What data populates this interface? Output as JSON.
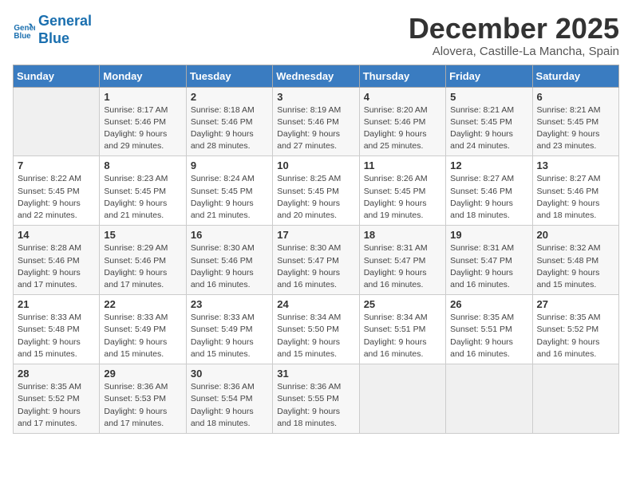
{
  "logo": {
    "line1": "General",
    "line2": "Blue"
  },
  "title": "December 2025",
  "location": "Alovera, Castille-La Mancha, Spain",
  "days_of_week": [
    "Sunday",
    "Monday",
    "Tuesday",
    "Wednesday",
    "Thursday",
    "Friday",
    "Saturday"
  ],
  "weeks": [
    [
      {
        "num": "",
        "info": ""
      },
      {
        "num": "1",
        "info": "Sunrise: 8:17 AM\nSunset: 5:46 PM\nDaylight: 9 hours\nand 29 minutes."
      },
      {
        "num": "2",
        "info": "Sunrise: 8:18 AM\nSunset: 5:46 PM\nDaylight: 9 hours\nand 28 minutes."
      },
      {
        "num": "3",
        "info": "Sunrise: 8:19 AM\nSunset: 5:46 PM\nDaylight: 9 hours\nand 27 minutes."
      },
      {
        "num": "4",
        "info": "Sunrise: 8:20 AM\nSunset: 5:46 PM\nDaylight: 9 hours\nand 25 minutes."
      },
      {
        "num": "5",
        "info": "Sunrise: 8:21 AM\nSunset: 5:45 PM\nDaylight: 9 hours\nand 24 minutes."
      },
      {
        "num": "6",
        "info": "Sunrise: 8:21 AM\nSunset: 5:45 PM\nDaylight: 9 hours\nand 23 minutes."
      }
    ],
    [
      {
        "num": "7",
        "info": "Sunrise: 8:22 AM\nSunset: 5:45 PM\nDaylight: 9 hours\nand 22 minutes."
      },
      {
        "num": "8",
        "info": "Sunrise: 8:23 AM\nSunset: 5:45 PM\nDaylight: 9 hours\nand 21 minutes."
      },
      {
        "num": "9",
        "info": "Sunrise: 8:24 AM\nSunset: 5:45 PM\nDaylight: 9 hours\nand 21 minutes."
      },
      {
        "num": "10",
        "info": "Sunrise: 8:25 AM\nSunset: 5:45 PM\nDaylight: 9 hours\nand 20 minutes."
      },
      {
        "num": "11",
        "info": "Sunrise: 8:26 AM\nSunset: 5:45 PM\nDaylight: 9 hours\nand 19 minutes."
      },
      {
        "num": "12",
        "info": "Sunrise: 8:27 AM\nSunset: 5:46 PM\nDaylight: 9 hours\nand 18 minutes."
      },
      {
        "num": "13",
        "info": "Sunrise: 8:27 AM\nSunset: 5:46 PM\nDaylight: 9 hours\nand 18 minutes."
      }
    ],
    [
      {
        "num": "14",
        "info": "Sunrise: 8:28 AM\nSunset: 5:46 PM\nDaylight: 9 hours\nand 17 minutes."
      },
      {
        "num": "15",
        "info": "Sunrise: 8:29 AM\nSunset: 5:46 PM\nDaylight: 9 hours\nand 17 minutes."
      },
      {
        "num": "16",
        "info": "Sunrise: 8:30 AM\nSunset: 5:46 PM\nDaylight: 9 hours\nand 16 minutes."
      },
      {
        "num": "17",
        "info": "Sunrise: 8:30 AM\nSunset: 5:47 PM\nDaylight: 9 hours\nand 16 minutes."
      },
      {
        "num": "18",
        "info": "Sunrise: 8:31 AM\nSunset: 5:47 PM\nDaylight: 9 hours\nand 16 minutes."
      },
      {
        "num": "19",
        "info": "Sunrise: 8:31 AM\nSunset: 5:47 PM\nDaylight: 9 hours\nand 16 minutes."
      },
      {
        "num": "20",
        "info": "Sunrise: 8:32 AM\nSunset: 5:48 PM\nDaylight: 9 hours\nand 15 minutes."
      }
    ],
    [
      {
        "num": "21",
        "info": "Sunrise: 8:33 AM\nSunset: 5:48 PM\nDaylight: 9 hours\nand 15 minutes."
      },
      {
        "num": "22",
        "info": "Sunrise: 8:33 AM\nSunset: 5:49 PM\nDaylight: 9 hours\nand 15 minutes."
      },
      {
        "num": "23",
        "info": "Sunrise: 8:33 AM\nSunset: 5:49 PM\nDaylight: 9 hours\nand 15 minutes."
      },
      {
        "num": "24",
        "info": "Sunrise: 8:34 AM\nSunset: 5:50 PM\nDaylight: 9 hours\nand 15 minutes."
      },
      {
        "num": "25",
        "info": "Sunrise: 8:34 AM\nSunset: 5:51 PM\nDaylight: 9 hours\nand 16 minutes."
      },
      {
        "num": "26",
        "info": "Sunrise: 8:35 AM\nSunset: 5:51 PM\nDaylight: 9 hours\nand 16 minutes."
      },
      {
        "num": "27",
        "info": "Sunrise: 8:35 AM\nSunset: 5:52 PM\nDaylight: 9 hours\nand 16 minutes."
      }
    ],
    [
      {
        "num": "28",
        "info": "Sunrise: 8:35 AM\nSunset: 5:52 PM\nDaylight: 9 hours\nand 17 minutes."
      },
      {
        "num": "29",
        "info": "Sunrise: 8:36 AM\nSunset: 5:53 PM\nDaylight: 9 hours\nand 17 minutes."
      },
      {
        "num": "30",
        "info": "Sunrise: 8:36 AM\nSunset: 5:54 PM\nDaylight: 9 hours\nand 18 minutes."
      },
      {
        "num": "31",
        "info": "Sunrise: 8:36 AM\nSunset: 5:55 PM\nDaylight: 9 hours\nand 18 minutes."
      },
      {
        "num": "",
        "info": ""
      },
      {
        "num": "",
        "info": ""
      },
      {
        "num": "",
        "info": ""
      }
    ]
  ]
}
